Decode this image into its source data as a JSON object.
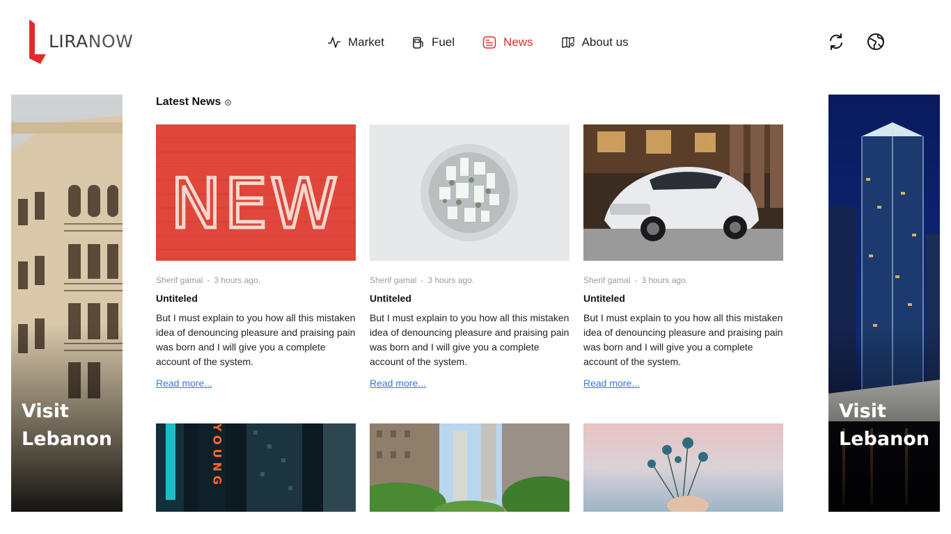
{
  "brand": {
    "logo_text_bold": "LIRA",
    "logo_text_light": "NOW",
    "accent": "#e32b2b"
  },
  "nav": {
    "items": [
      {
        "label": "Market",
        "icon": "activity-icon"
      },
      {
        "label": "Fuel",
        "icon": "fuel-pump-icon"
      },
      {
        "label": "News",
        "icon": "newspaper-icon",
        "active": true
      },
      {
        "label": "About us",
        "icon": "book-map-icon"
      }
    ]
  },
  "header_icons": [
    "refresh-icon",
    "globe-icon"
  ],
  "side_banners": {
    "left": {
      "line1": "Visit",
      "line2": "Lebanon"
    },
    "right": {
      "line1": "Visit",
      "line2": "Lebanon"
    }
  },
  "news": {
    "section_title": "Latest News",
    "cards": [
      {
        "author": "Sherif gamal",
        "separator": "-",
        "time": "3 hours ago.",
        "title": "Untiteled",
        "body": "But I must explain to you how all this mistaken idea of denouncing pleasure and praising pain was born and I will give you a complete account of the system.",
        "link": "Read more..."
      },
      {
        "author": "Sherif gamal",
        "separator": "-",
        "time": "3 hours ago.",
        "title": "Untiteled",
        "body": "But I must explain to you how all this mistaken idea of denouncing pleasure and praising pain was born and I will give you a complete account of the system.",
        "link": "Read more..."
      },
      {
        "author": "Sherif gamal",
        "separator": "-",
        "time": "3 hours ago.",
        "title": "Untiteled",
        "body": "But I must explain to you how all this mistaken idea of denouncing pleasure and praising pain was born and I will give you a complete account of the system.",
        "link": "Read more..."
      }
    ],
    "new_sign_text": "NEW",
    "neon_sign_text": "YOUNG"
  }
}
